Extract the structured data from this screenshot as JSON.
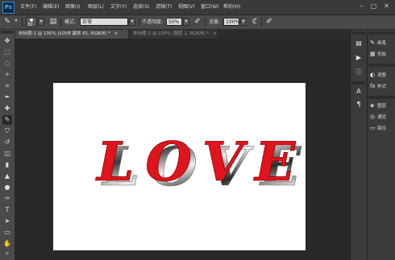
{
  "app": {
    "logo": "Ps"
  },
  "menu": [
    "文件(F)",
    "编辑(E)",
    "图像(I)",
    "图层(L)",
    "文字(Y)",
    "选择(S)",
    "滤镜(T)",
    "视图(V)",
    "窗口(W)",
    "帮助(H)"
  ],
  "window_controls": {
    "minimize": "–",
    "restore": "▢",
    "close": "✕"
  },
  "options": {
    "brush_size": "30",
    "mode_label": "模式:",
    "mode_value": "正常",
    "opacity_label": "不透明度:",
    "opacity_value": "50%",
    "flow_label": "流量:",
    "flow_value": "100%"
  },
  "tabs": [
    {
      "label": "未标题-1 @ 100% (LOVE 副本 61, RGB/8) *",
      "close": "×",
      "active": true
    },
    {
      "label": "未标题-2 @ 100% (图层 1, RGB/8) *",
      "close": "×",
      "active": false
    }
  ],
  "canvas": {
    "text": "LOVE",
    "background": "#ffffff",
    "text_color": "#e0141c"
  },
  "panels": {
    "group1": [
      {
        "icon": "brush-preset-icon",
        "glyph": "✎",
        "label": "画笔"
      },
      {
        "icon": "swatches-icon",
        "glyph": "▦",
        "label": "色板"
      }
    ],
    "group2": [
      {
        "icon": "adjustments-icon",
        "glyph": "◐",
        "label": "调整"
      },
      {
        "icon": "styles-icon",
        "glyph": "fx",
        "label": "样式"
      }
    ],
    "group3": [
      {
        "icon": "layers-icon",
        "glyph": "◈",
        "label": "图层"
      },
      {
        "icon": "channels-icon",
        "glyph": "◎",
        "label": "通道"
      },
      {
        "icon": "paths-icon",
        "glyph": "▭",
        "label": "路径"
      }
    ]
  }
}
